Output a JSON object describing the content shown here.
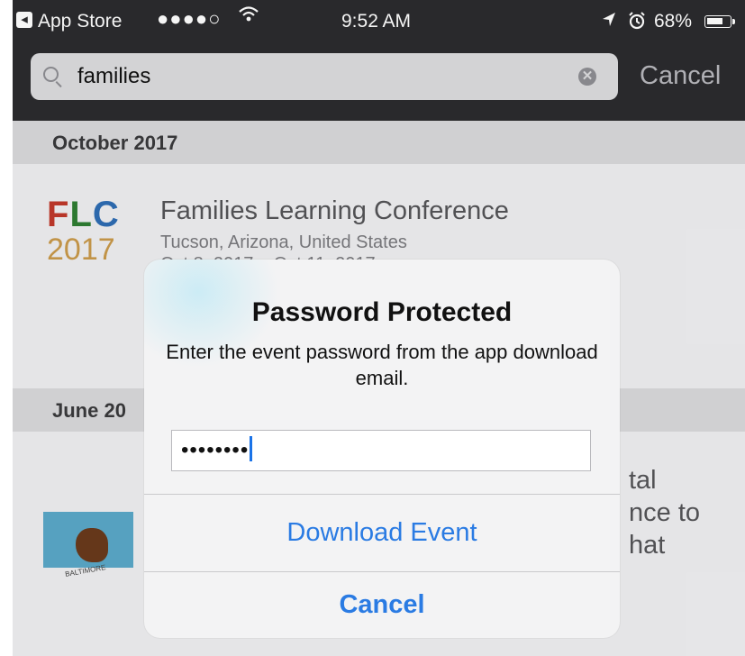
{
  "status_bar": {
    "back_app": "App Store",
    "signal": "●●●●○",
    "wifi_icon": "wifi-icon",
    "time": "9:52 AM",
    "battery": "68%"
  },
  "search": {
    "query": "families",
    "cancel_label": "Cancel"
  },
  "sections": [
    {
      "header": "October 2017",
      "event": {
        "logo_line1": [
          "F",
          "L",
          "C"
        ],
        "logo_line2": "2017",
        "logo_colors": [
          "#c0392b",
          "#2e7d32",
          "#2e6db4"
        ],
        "title": "Families Learning Conference",
        "location": "Tucson, Arizona, United States",
        "dates": "Oct 8, 2017 – Oct 11, 2017"
      }
    },
    {
      "header": "June 20",
      "event": {
        "title_fragments": [
          "tal",
          "nce to",
          "hat"
        ],
        "logo_caption": "BALTIMORE"
      }
    }
  ],
  "alert": {
    "title": "Password Protected",
    "message": "Enter the event password from the app download email.",
    "password_masked": "••••••••",
    "download_label": "Download Event",
    "cancel_label": "Cancel"
  },
  "colors": {
    "accent": "#2a7be3",
    "bar": "#2b2b2e"
  }
}
